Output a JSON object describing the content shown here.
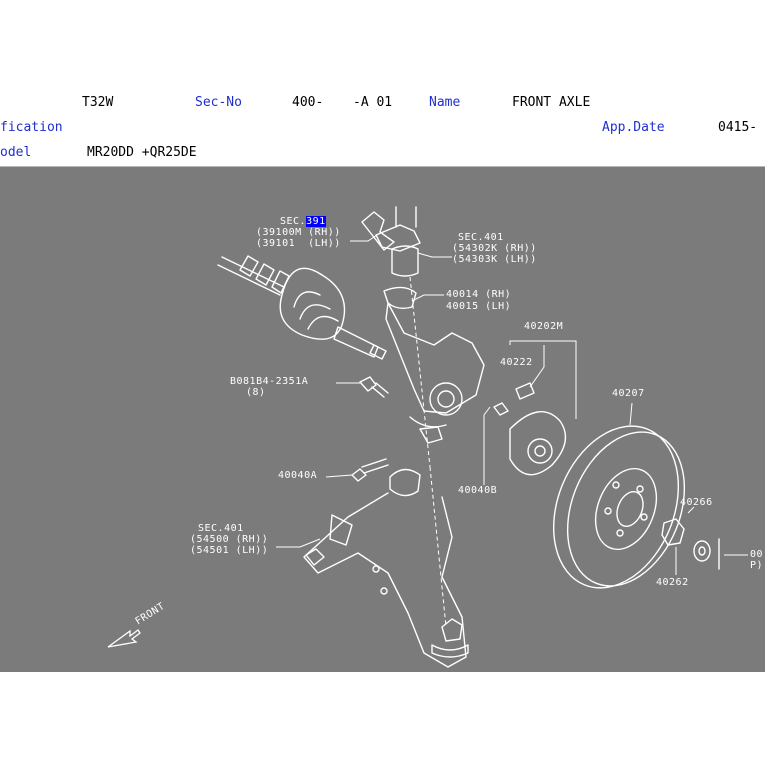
{
  "header": {
    "model_code": "T32W",
    "sec_no_label": "Sec-No",
    "sec_no_value": "400-",
    "sec_no_suffix": "-A 01",
    "name_label": "Name",
    "name_value": "FRONT AXLE",
    "spec_label": "fication",
    "app_date_label": "App.Date",
    "app_date_value": "0415-",
    "model_label": "odel",
    "model_value": "MR20DD +QR25DE"
  },
  "diagram": {
    "background": "#7b7b7b",
    "callouts": {
      "sec391_a": "SEC.",
      "sec391_b": "391",
      "p39100m": "(39100M (RH))",
      "p39101": "(39101  (LH))",
      "sec401_top": "SEC.401",
      "p54302k": "(54302K (RH))",
      "p54303k": "(54303K (LH))",
      "p40014": "40014 (RH)",
      "p40015": "40015 (LH)",
      "p40202m": "40202M",
      "p40222": "40222",
      "bolt_code": "B081B4-2351A",
      "bolt_qty": "(8)",
      "p40207": "40207",
      "p40040a": "40040A",
      "p40040b": "40040B",
      "p40266": "40266",
      "p40262": "40262",
      "sec401_bottom": "SEC.401",
      "p54500": "(54500 (RH))",
      "p54501": "(54501 (LH))",
      "p00_a": "00",
      "p00_b": "P)",
      "front": "FRONT"
    }
  }
}
